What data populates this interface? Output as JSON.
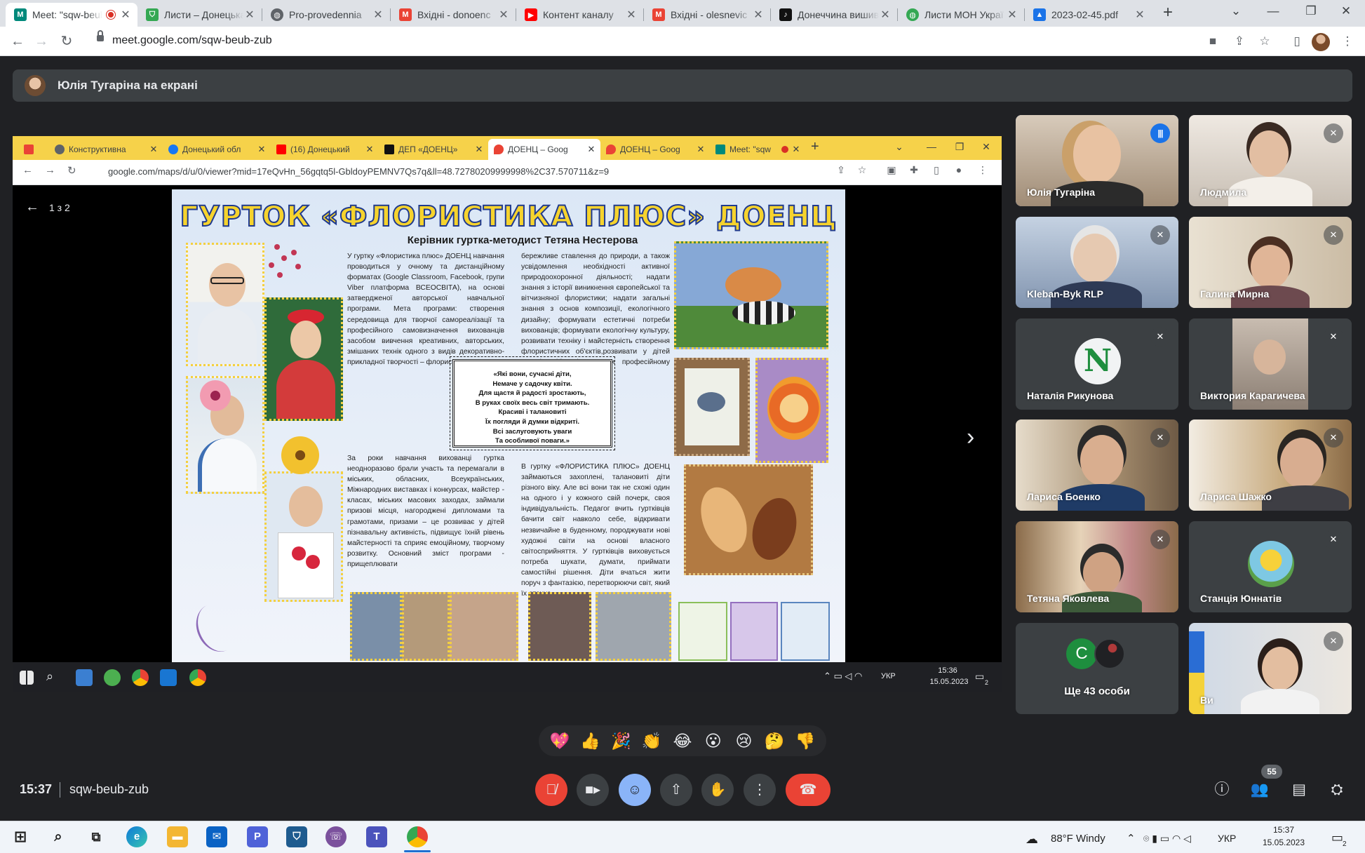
{
  "browser": {
    "tabs": [
      {
        "label": "Meet: \"sqw-beub-zub\"",
        "icon": "meet-icon",
        "color": "#00897b"
      },
      {
        "label": "Листи – Донецька",
        "icon": "shield-icon",
        "color": "#34a853"
      },
      {
        "label": "Pro-provedennia",
        "icon": "globe-icon",
        "color": "#5f6368"
      },
      {
        "label": "Вхідні - donoenc",
        "icon": "gmail-icon",
        "color": "#ea4335"
      },
      {
        "label": "Контент каналу",
        "icon": "youtube-icon",
        "color": "#ff0000"
      },
      {
        "label": "Вхідні - olesnevic",
        "icon": "gmail-icon",
        "color": "#ea4335"
      },
      {
        "label": "Донеччина вишив",
        "icon": "tiktok-icon",
        "color": "#111111"
      },
      {
        "label": "Листи МОН Украї",
        "icon": "globe-icon",
        "color": "#34a853"
      },
      {
        "label": "2023-02-45.pdf",
        "icon": "drive-icon",
        "color": "#1a73e8"
      }
    ],
    "url": "meet.google.com/sqw-beub-zub"
  },
  "presenting": {
    "text": "Юлія Тугаріна на екрані"
  },
  "shared_screen": {
    "tabs": [
      {
        "label": "",
        "icon": "gmail-icon",
        "color": "#ea4335"
      },
      {
        "label": "Конструктивна",
        "icon": "chrome-icon",
        "color": "#5f6368"
      },
      {
        "label": "Донецький обл",
        "icon": "facebook-icon",
        "color": "#1877f2"
      },
      {
        "label": "(16) Донецький",
        "icon": "youtube-icon",
        "color": "#ff0000"
      },
      {
        "label": "ДЕП «ДОЕНЦ»",
        "icon": "tiktok-icon",
        "color": "#111111"
      },
      {
        "label": "ДОЕНЦ – Goog",
        "icon": "maps-icon",
        "color": "#ea4335"
      },
      {
        "label": "ДОЕНЦ – Goog",
        "icon": "maps-icon",
        "color": "#ea4335"
      },
      {
        "label": "Meet: \"sqw",
        "icon": "meet-icon",
        "color": "#00897b"
      }
    ],
    "url": "google.com/maps/d/u/0/viewer?mid=17eQvHn_56gqtq5l-GbldoyPEMNV7Qs7q&ll=48.72780209999998%2C37.570711&z=9",
    "page_indicator": "1 з 2",
    "poster": {
      "title": "ГУРТОК «ФЛОРИСТИКА ПЛЮС» ДОЕНЦ",
      "subtitle": "Керівник гуртка-методист Тетяна Нестерова",
      "col1": "У гуртку «Флористика плюс» ДОЕНЦ навчання проводиться у очному та дистанційному форматах (Google Classroom, Facebook, групи Viber платформа ВСЕОСВІТА), на основі затвердженої авторської навчальної програми. Мета програми: створення середовища для творчої самореалізації та професійного самовизначення вихованців засобом вивчення креативних, авторських, змішаних технік одного з видів декоративно-прикладної творчості – флористики.",
      "col1b": "За роки навчання вихованці гуртка неодноразово брали участь та перемагали в міських, обласних, Всеукраїнських, Міжнародних виставках і конкурсах, майстер - класах, міських масових заходах, займали призові місця, нагороджені дипломами та грамотами, призами – це розвиває у дітей пізнавальну активність, підвищує їхній рівень майстерності та сприяє емоційному, творчому розвитку. Основний зміст програми - прищеплювати",
      "col2": "бережливе ставлення до природи, а також усвідомлення необхідності активної природоохоронної діяльності; надати знання з історії виникнення європейської та вітчизняної флористики; надати загальні знання з основ композиції, екологічного дизайну; формувати естетичні потреби вихованців; формувати екологічну культуру, розвивати техніку і майстерність створення флористичних об'єктів,розвивати у дітей творчі здібності; сприяти професійному самовизначенню.",
      "col2b": "В гуртку «ФЛОРИСТИКА ПЛЮС» ДОЕНЦ займаються захоплені, талановиті діти різного віку. Але всі вони так не схожі один на одного і у кожного свій почерк, своя індивідуальність. Педагог вчить гуртківців бачити світ навколо себе, відкривати незвичайне в буденному, породжувати нові художні світи на основі власного світосприйняття. У гуртківців виховується потреба шукати, думати, приймати самостійні рішення. Діти вчаться жити поруч з фантазією, перетворюючи світ, який їх оточує.",
      "quote": [
        "«Які вони, сучасні діти,",
        "Немаче у садочку квіти.",
        "Для щастя й радості зростають,",
        "В руках своїх весь світ тримають.",
        "Красиві і талановиті",
        "Їх погляди й думки відкриті.",
        "Всі заслуговують уваги",
        "Та особливої поваги.»"
      ]
    },
    "taskbar": {
      "lang": "УКР",
      "time": "15:36",
      "date": "15.05.2023",
      "notifications": "2"
    }
  },
  "participants": [
    {
      "name": "Юлія Тугаріна",
      "state": "speaking",
      "tone": "#c9b49d"
    },
    {
      "name": "Людмила",
      "state": "muted",
      "tone": "#d9cfc4"
    },
    {
      "name": "Kleban-Byk RLP",
      "state": "muted",
      "tone": "#b7c4d6"
    },
    {
      "name": "Галина Мирна",
      "state": "muted",
      "tone": "#ded2bf"
    },
    {
      "name": "Наталія Рикунова",
      "state": "muted",
      "initial": "N"
    },
    {
      "name": "Виктория Карагичева",
      "state": "muted",
      "tone": "#3c4043"
    },
    {
      "name": "Лариса Боенко",
      "state": "muted",
      "tone": "#b9a78f"
    },
    {
      "name": "Лариса Шажко",
      "state": "muted",
      "tone": "#c8b99f"
    },
    {
      "name": "Тетяна Яковлева",
      "state": "muted",
      "tone": "#a88f70"
    },
    {
      "name": "Станція Юннатів",
      "state": "muted",
      "tone": "#3c4043"
    },
    {
      "name": "Ще 43 особи",
      "state": "more",
      "initial": "C"
    },
    {
      "name": "Ви",
      "state": "muted",
      "tone": "#c9c2b8"
    }
  ],
  "reactions": [
    "💖",
    "👍",
    "🎉",
    "👏",
    "😂",
    "😮",
    "😢",
    "🤔",
    "👎"
  ],
  "meeting": {
    "time": "15:37",
    "code": "sqw-beub-zub",
    "participant_count": "55"
  },
  "taskbar": {
    "weather": "88°F Windy",
    "lang": "УКР",
    "time": "15:37",
    "date": "15.05.2023",
    "notifications": "2"
  }
}
